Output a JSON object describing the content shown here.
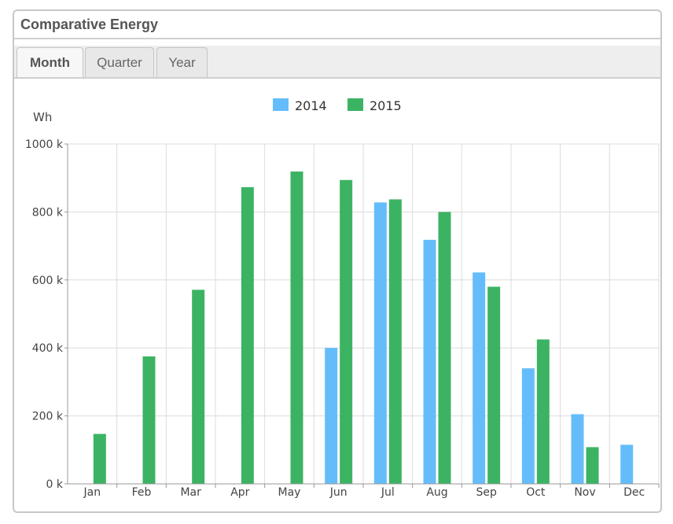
{
  "panel": {
    "title": "Comparative Energy"
  },
  "tabs": [
    {
      "label": "Month",
      "active": true
    },
    {
      "label": "Quarter",
      "active": false
    },
    {
      "label": "Year",
      "active": false
    }
  ],
  "chart_data": {
    "type": "bar",
    "unit_label": "Wh",
    "categories": [
      "Jan",
      "Feb",
      "Mar",
      "Apr",
      "May",
      "Jun",
      "Jul",
      "Aug",
      "Sep",
      "Oct",
      "Nov",
      "Dec"
    ],
    "series": [
      {
        "name": "2014",
        "color": "#64bdfa",
        "values": [
          0,
          0,
          0,
          0,
          0,
          400,
          828,
          718,
          622,
          340,
          205,
          115
        ]
      },
      {
        "name": "2015",
        "color": "#3cb363",
        "values": [
          147,
          375,
          571,
          873,
          919,
          894,
          837,
          800,
          580,
          425,
          108,
          0
        ]
      }
    ],
    "ylim": [
      0,
      1000
    ],
    "yticks": [
      0,
      200,
      400,
      600,
      800,
      1000
    ],
    "ytick_labels": [
      "0 k",
      "200 k",
      "400 k",
      "600 k",
      "800 k",
      "1000 k"
    ],
    "values_unit": "k",
    "grid": true,
    "legend_position": "top-center"
  }
}
